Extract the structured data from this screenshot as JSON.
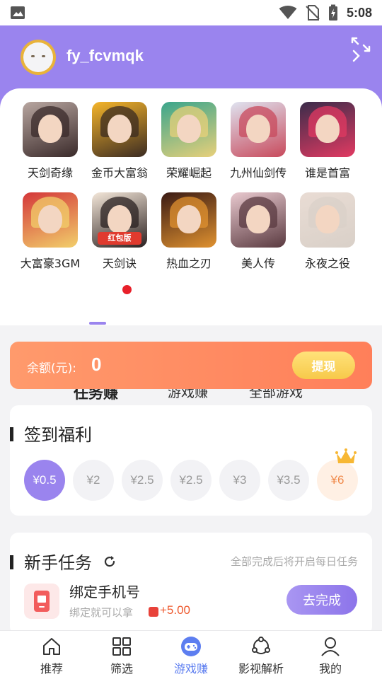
{
  "status_bar": {
    "time": "5:08",
    "icons": [
      "image-icon",
      "wifi-icon",
      "no-sim-icon",
      "battery-charging-icon"
    ]
  },
  "header": {
    "username": "fy_fcvmqk"
  },
  "games": [
    {
      "name": "天剑奇缘",
      "colors": [
        "#b8a6a0",
        "#3a2a2a"
      ]
    },
    {
      "name": "金币大富翁",
      "colors": [
        "#f5b52a",
        "#3b2b22"
      ]
    },
    {
      "name": "荣耀崛起",
      "colors": [
        "#3aa58c",
        "#e8d07a"
      ]
    },
    {
      "name": "九州仙剑传",
      "colors": [
        "#dfe3f0",
        "#c84a5c"
      ]
    },
    {
      "name": "谁是首富",
      "colors": [
        "#3a2c4a",
        "#e23a62"
      ]
    },
    {
      "name": "大富豪3GM",
      "colors": [
        "#d4373a",
        "#f2cf6b"
      ]
    },
    {
      "name": "天剑诀",
      "colors": [
        "#f4e7d9",
        "#2a2020"
      ],
      "tag": "红包版"
    },
    {
      "name": "热血之刃",
      "colors": [
        "#3a1a14",
        "#e09230"
      ]
    },
    {
      "name": "美人传",
      "colors": [
        "#e9c9cf",
        "#5a3a40"
      ]
    },
    {
      "name": "永夜之役",
      "colors": [
        "#e9dcd4",
        "#d9d0c8"
      ]
    }
  ],
  "tabs": [
    {
      "label": "任务赚",
      "active": true
    },
    {
      "label": "游戏赚",
      "active": false
    },
    {
      "label": "全部游戏",
      "active": false
    }
  ],
  "balance": {
    "label": "余额(元):",
    "amount": "0",
    "button": "提现"
  },
  "signin": {
    "title": "签到福利",
    "rewards": [
      "¥0.5",
      "¥2",
      "¥2.5",
      "¥2.5",
      "¥3",
      "¥3.5",
      "¥6"
    ]
  },
  "newbie": {
    "title": "新手任务",
    "hint": "全部完成后将开启每日任务",
    "task": {
      "title": "绑定手机号",
      "desc": "绑定就可以拿",
      "reward": "+5.00",
      "button": "去完成"
    }
  },
  "nav": [
    {
      "label": "推荐",
      "icon": "home-icon",
      "active": false
    },
    {
      "label": "筛选",
      "icon": "grid-icon",
      "active": false
    },
    {
      "label": "游戏赚",
      "icon": "gamepad-icon",
      "active": true
    },
    {
      "label": "影视解析",
      "icon": "share-icon",
      "active": false
    },
    {
      "label": "我的",
      "icon": "user-icon",
      "active": false
    }
  ],
  "colors": {
    "accent": "#9a84ee",
    "balance": "#ff8a62",
    "active_nav": "#5d7ef0"
  }
}
